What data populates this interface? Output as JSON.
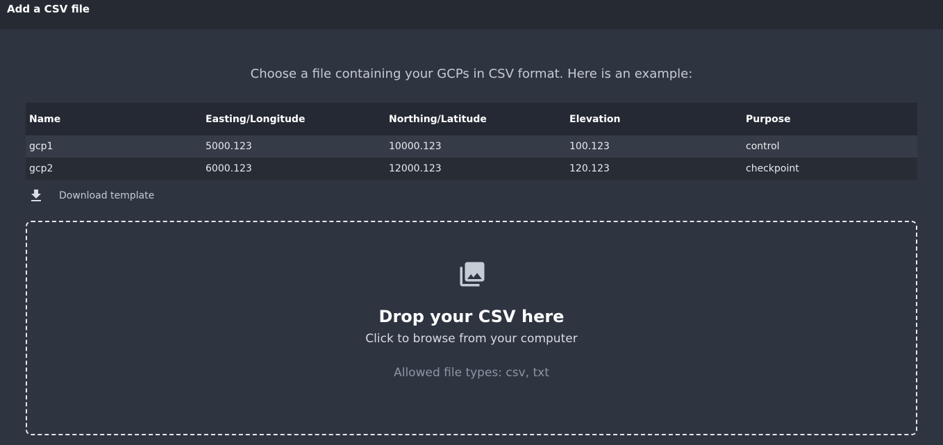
{
  "header": {
    "title": "Add a CSV file"
  },
  "intro": {
    "text": "Choose a file containing your GCPs in CSV format. Here is an example:"
  },
  "table": {
    "columns": [
      "Name",
      "Easting/Longitude",
      "Northing/Latitude",
      "Elevation",
      "Purpose"
    ],
    "rows": [
      [
        "gcp1",
        "5000.123",
        "10000.123",
        "100.123",
        "control"
      ],
      [
        "gcp2",
        "6000.123",
        "12000.123",
        "120.123",
        "checkpoint"
      ]
    ]
  },
  "download": {
    "icon": "download-icon",
    "label": "Download template"
  },
  "dropzone": {
    "icon": "image-library-icon",
    "title": "Drop your CSV here",
    "subtitle": "Click to browse from your computer",
    "allowed": "Allowed file types: csv, txt"
  },
  "colors": {
    "background": "#2e3440",
    "header_bg": "#262b33",
    "table_header_bg": "#242933",
    "row_odd_bg": "#353b47",
    "row_even_bg": "#272c35"
  }
}
